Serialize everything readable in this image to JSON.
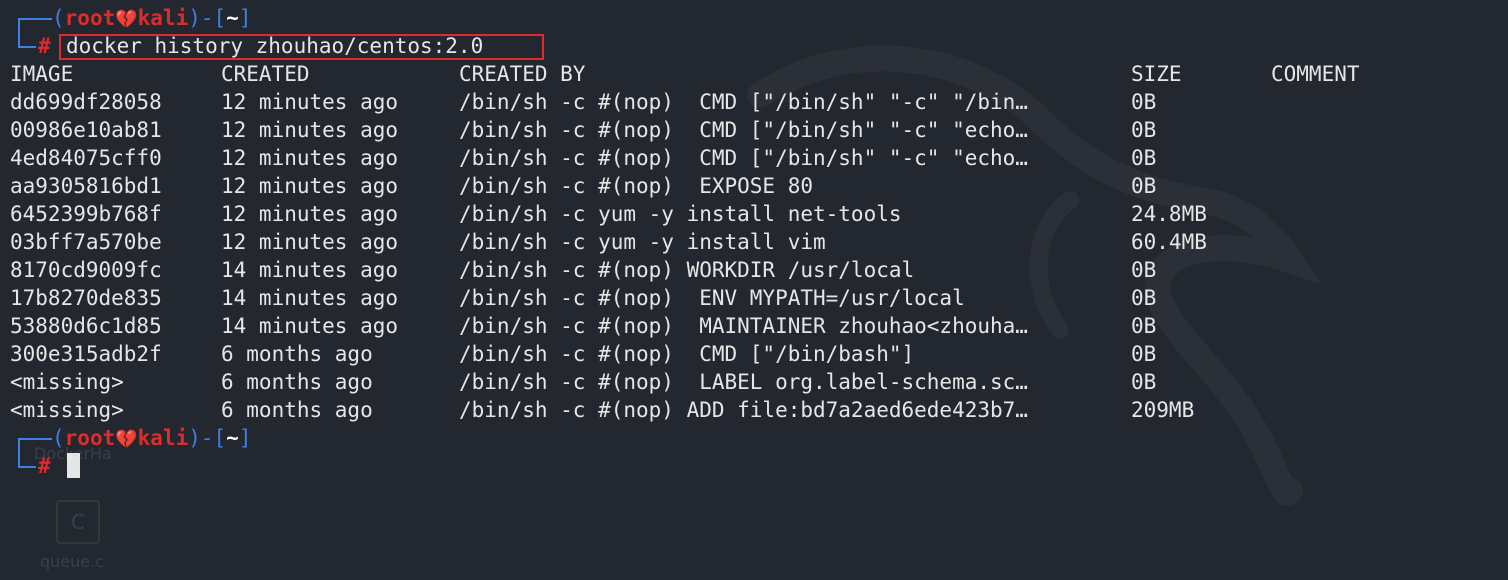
{
  "prompt": {
    "user": "root",
    "heart_icon": "broken-heart-icon",
    "host": "kali",
    "dir": "~",
    "symbol": "#"
  },
  "command": "docker history zhouhao/centos:2.0",
  "table": {
    "headers": [
      "IMAGE",
      "CREATED",
      "CREATED BY",
      "SIZE",
      "COMMENT"
    ],
    "rows": [
      [
        "dd699df28058",
        "12 minutes ago",
        "/bin/sh -c #(nop)  CMD [\"/bin/sh\" \"-c\" \"/bin…",
        "0B",
        ""
      ],
      [
        "00986e10ab81",
        "12 minutes ago",
        "/bin/sh -c #(nop)  CMD [\"/bin/sh\" \"-c\" \"echo…",
        "0B",
        ""
      ],
      [
        "4ed84075cff0",
        "12 minutes ago",
        "/bin/sh -c #(nop)  CMD [\"/bin/sh\" \"-c\" \"echo…",
        "0B",
        ""
      ],
      [
        "aa9305816bd1",
        "12 minutes ago",
        "/bin/sh -c #(nop)  EXPOSE 80",
        "0B",
        ""
      ],
      [
        "6452399b768f",
        "12 minutes ago",
        "/bin/sh -c yum -y install net-tools",
        "24.8MB",
        ""
      ],
      [
        "03bff7a570be",
        "12 minutes ago",
        "/bin/sh -c yum -y install vim",
        "60.4MB",
        ""
      ],
      [
        "8170cd9009fc",
        "14 minutes ago",
        "/bin/sh -c #(nop) WORKDIR /usr/local",
        "0B",
        ""
      ],
      [
        "17b8270de835",
        "14 minutes ago",
        "/bin/sh -c #(nop)  ENV MYPATH=/usr/local",
        "0B",
        ""
      ],
      [
        "53880d6c1d85",
        "14 minutes ago",
        "/bin/sh -c #(nop)  MAINTAINER zhouhao<zhouha…",
        "0B",
        ""
      ],
      [
        "300e315adb2f",
        "6 months ago",
        "/bin/sh -c #(nop)  CMD [\"/bin/bash\"]",
        "0B",
        ""
      ],
      [
        "<missing>",
        "6 months ago",
        "/bin/sh -c #(nop)  LABEL org.label-schema.sc…",
        "0B",
        ""
      ],
      [
        "<missing>",
        "6 months ago",
        "/bin/sh -c #(nop) ADD file:bd7a2aed6ede423b7…",
        "209MB",
        ""
      ]
    ]
  },
  "colors": {
    "background": "#23272f",
    "prompt_frame": "#3e7fe6",
    "prompt_user": "#e02b2b",
    "text": "#e6e6e6",
    "highlight_box": "#e02b2b"
  },
  "desktop_icons": [
    {
      "name": "folder-icon",
      "label": "DockerHa"
    },
    {
      "name": "c-file-icon",
      "label": "queue.c"
    }
  ]
}
